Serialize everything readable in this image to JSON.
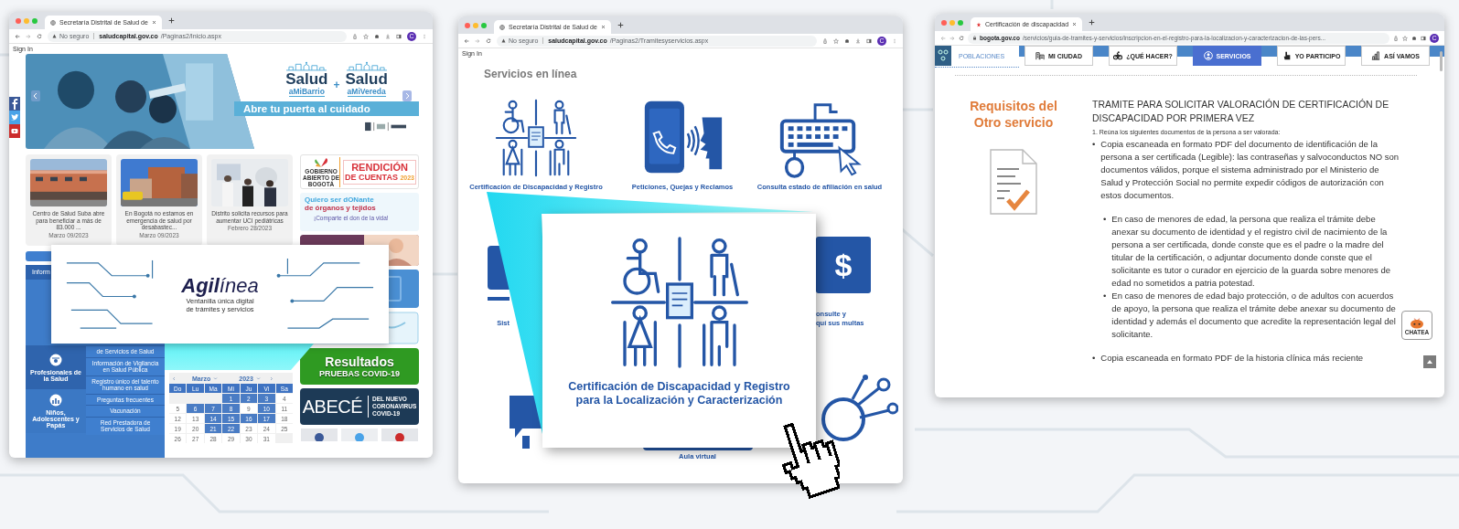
{
  "home_window": {
    "tab": {
      "title": "Secretaría Distrital de Salud de"
    },
    "address": {
      "security": "No seguro",
      "host": "saludcapital.gov.co",
      "path": "/Paginas2/Inicio.aspx"
    },
    "avatar": "C",
    "sign_in": "Sign In",
    "banner": {
      "brands": [
        {
          "word": "Salud",
          "suffix": "aMiBarrio"
        },
        {
          "word": "Salud",
          "suffix": "aMiVereda"
        }
      ],
      "plus": "+",
      "slogan": "Abre tu puerta al cuidado"
    },
    "news": [
      {
        "kind": "clinic",
        "title": "Centro de Salud Suba abre para beneficiar a más de 83.000 ...",
        "date": "Marzo 09/2023"
      },
      {
        "kind": "hospital",
        "title": "En Bogotá no estamos en emergencia de salud por desabastec...",
        "date": "Marzo 09/2023"
      },
      {
        "kind": "meeting",
        "title": "Distrito solicita recursos para aumentar UCI pediátricas",
        "date": "Febrero 28/2023"
      }
    ],
    "ads": [
      {
        "kind": "rendicion",
        "org": "GOBIERNO ABIERTO DE BOGOTÁ",
        "title": "RENDICIÓN",
        "subtitle": "DE CUENTAS",
        "year": "2023"
      },
      {
        "kind": "donante",
        "title": "Quiero ser dONante",
        "subtitle": "de órganos y tejidos",
        "note": "¡Comparte el don de la vida!"
      },
      {
        "kind": "picture"
      },
      {
        "kind": "screen"
      },
      {
        "kind": "pale"
      },
      {
        "kind": "covid",
        "title": "Resultados",
        "subtitle": "PRUEBAS COVID-19"
      },
      {
        "kind": "abece",
        "title": "ABECÉ",
        "lines": [
          "DEL NUEVO",
          "CORONAVIRUS",
          "COVID-19"
        ]
      }
    ],
    "menu": {
      "title": "Inform",
      "categories": [
        {
          "label": "Profesionales de la Salud",
          "selected": true
        },
        {
          "label": "Niños, Adolescentes y Papás",
          "selected": false
        }
      ],
      "links": [
        "de Servicios de Salud",
        "Información de Vigilancia en Salud Pública",
        "Registro único del talento humano en salud",
        "Preguntas frecuentes",
        "Vacunación",
        "Red Prestadora de Servicios de Salud"
      ]
    },
    "calendar": {
      "month": "Marzo",
      "year": "2023",
      "weekdays": [
        "Do",
        "Lu",
        "Ma",
        "Mi",
        "Ju",
        "Vi",
        "Sa"
      ],
      "days": [
        {
          "kind": "blank"
        },
        {
          "kind": "blank"
        },
        {
          "kind": "blank"
        },
        {
          "kind": "day",
          "label": "1",
          "marked": true
        },
        {
          "kind": "day",
          "label": "2",
          "marked": true
        },
        {
          "kind": "day",
          "label": "3",
          "marked": true
        },
        {
          "kind": "day",
          "label": "4",
          "marked": false
        },
        {
          "kind": "day",
          "label": "5",
          "marked": false
        },
        {
          "kind": "day",
          "label": "6",
          "marked": true
        },
        {
          "kind": "day",
          "label": "7",
          "marked": true
        },
        {
          "kind": "day",
          "label": "8",
          "marked": true
        },
        {
          "kind": "day",
          "label": "9",
          "marked": false
        },
        {
          "kind": "day",
          "label": "10",
          "marked": true
        },
        {
          "kind": "day",
          "label": "11",
          "marked": false
        },
        {
          "kind": "day",
          "label": "12",
          "marked": false
        },
        {
          "kind": "day",
          "label": "13",
          "marked": false
        },
        {
          "kind": "day",
          "label": "14",
          "marked": true
        },
        {
          "kind": "day",
          "label": "15",
          "marked": true
        },
        {
          "kind": "day",
          "label": "16",
          "marked": true
        },
        {
          "kind": "day",
          "label": "17",
          "marked": true
        },
        {
          "kind": "day",
          "label": "18",
          "marked": false
        },
        {
          "kind": "day",
          "label": "19",
          "marked": false
        },
        {
          "kind": "day",
          "label": "20",
          "marked": false
        },
        {
          "kind": "day",
          "label": "21",
          "marked": true
        },
        {
          "kind": "day",
          "label": "22",
          "marked": true
        },
        {
          "kind": "day",
          "label": "23",
          "marked": false
        },
        {
          "kind": "day",
          "label": "24",
          "marked": false
        },
        {
          "kind": "day",
          "label": "25",
          "marked": false
        },
        {
          "kind": "day",
          "label": "26",
          "marked": false
        },
        {
          "kind": "day",
          "label": "27",
          "marked": false
        },
        {
          "kind": "day",
          "label": "28",
          "marked": false
        },
        {
          "kind": "day",
          "label": "29",
          "marked": false
        },
        {
          "kind": "day",
          "label": "30",
          "marked": false
        },
        {
          "kind": "day",
          "label": "31",
          "marked": false
        },
        {
          "kind": "blank"
        }
      ]
    }
  },
  "agilinea": {
    "logo": "**Agil**ínea",
    "tagline": [
      "Ventanilla única digital",
      "de trámites y servicios"
    ]
  },
  "services_window": {
    "tab": {
      "title": "Secretaría Distrital de Salud de"
    },
    "address": {
      "security": "No seguro",
      "host": "saludcapital.gov.co",
      "path": "/Paginas2/Tramitesyservicios.aspx"
    },
    "avatar": "C",
    "sign_in": "Sign In",
    "heading": "Servicios en línea",
    "services": [
      {
        "kind": "disability",
        "label": "Certificación de Discapacidad y Registro"
      },
      {
        "kind": "phone",
        "label": "Peticiones, Quejas y Reclamos"
      },
      {
        "kind": "keyboard",
        "label": "Consulta estado de afiliación en salud"
      }
    ],
    "partial_left": "Sist",
    "partial_right": [
      "onsulte y",
      "quí sus multas"
    ],
    "fines_symbol": "$",
    "bottom_label": "Aula virtual"
  },
  "popup": {
    "title_lines": [
      "Certificación de Discapacidad y Registro",
      "para la Localización y Caracterización"
    ]
  },
  "detail_window": {
    "tab": {
      "title": "Certificación de discapacidad"
    },
    "address": {
      "host": "bogota.gov.co",
      "path": "/servicios/guia-de-tramites-y-servicios/inscripcion-en-el-registro-para-la-localizacion-y-caracterizacion-de-las-pers..."
    },
    "avatar": "C",
    "side_link": "POBLACIONES",
    "nav": [
      {
        "kind": "city",
        "label": "MI CIUDAD",
        "selected": false
      },
      {
        "kind": "activity",
        "label": "¿QUÉ HACER?",
        "selected": false
      },
      {
        "kind": "services",
        "label": "SERVICIOS",
        "selected": true
      },
      {
        "kind": "participate",
        "label": "YO PARTICIPO",
        "selected": false
      },
      {
        "kind": "progress",
        "label": "ASÍ VAMOS",
        "selected": false
      }
    ],
    "aside_title": "Requisitos del Otro servicio",
    "heading": "TRAMITE PARA SOLICITAR VALORACIÓN DE CERTIFICACIÓN DE DISCAPACIDAD POR PRIMERA VEZ",
    "step": "1. Reúna los siguientes documentos de la persona a ser valorada:",
    "items": [
      {
        "bullet": "•",
        "text": "Copia escaneada en formato PDF del documento de identificación de la persona a ser certificada (Legible): las contraseñas y salvoconductos NO son documentos válidos, porque el sistema administrado por el Ministerio de Salud y Protección Social no permite expedir códigos de autorización con estos documentos.",
        "children": [
          {
            "bullet": "•",
            "text": "En caso de menores de edad, la persona que realiza el trámite debe anexar su documento de identidad y el registro civil de nacimiento de la persona a ser certificada, donde conste que es el padre o la madre del titular de la certificación, o adjuntar documento donde conste que el solicitante es tutor o curador en ejercicio de la guarda sobre menores de edad no sometidos a patria potestad."
          },
          {
            "bullet": "•",
            "text": "En caso de menores de edad bajo protección, o de adultos con acuerdos de apoyo, la persona que realiza el trámite debe anexar su documento de identidad y además el documento que acredite la representación legal del solicitante."
          }
        ]
      },
      {
        "bullet": "•",
        "text": "Copia escaneada en formato PDF de la historia clínica más reciente"
      }
    ],
    "chat_badge": "CHATEA"
  }
}
